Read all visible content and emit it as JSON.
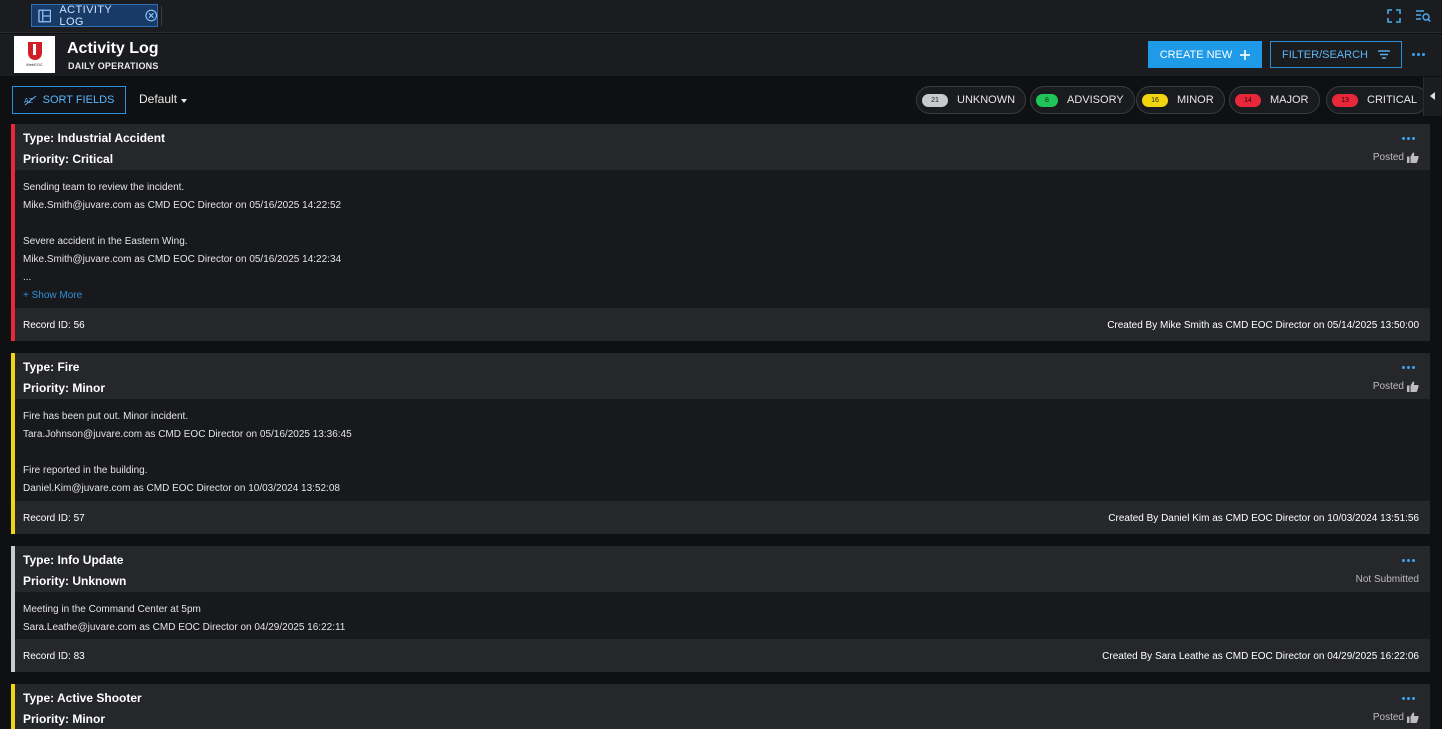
{
  "tab": {
    "label": "ACTIVITY LOG"
  },
  "header": {
    "title": "Activity Log",
    "subtitle": "DAILY OPERATIONS",
    "logo_text": "WebEOC"
  },
  "actions": {
    "create_new": "CREATE NEW",
    "filter_search": "FILTER/SEARCH"
  },
  "toolbar": {
    "sort_fields": "SORT FIELDS",
    "default_view": "Default"
  },
  "chips": [
    {
      "count": "21",
      "label": "UNKNOWN",
      "color": "#c8cacd"
    },
    {
      "count": "8",
      "label": "ADVISORY",
      "color": "#1fc45a"
    },
    {
      "count": "16",
      "label": "MINOR",
      "color": "#f1d60f"
    },
    {
      "count": "14",
      "label": "MAJOR",
      "color": "#e8283a"
    },
    {
      "count": "13",
      "label": "CRITICAL",
      "color": "#e8283a"
    }
  ],
  "cards": [
    {
      "type": "Type: Industrial Accident",
      "priority": "Priority: Critical",
      "status": "Posted",
      "bar_color": "#e8283a",
      "entries": [
        {
          "text": "Sending team to review the incident.",
          "meta": "Mike.Smith@juvare.com as CMD EOC Director on 05/16/2025 14:22:52"
        },
        {
          "text": "Severe accident in the Eastern Wing.",
          "meta": "Mike.Smith@juvare.com as CMD EOC Director on 05/16/2025 14:22:34"
        }
      ],
      "ellipsis": "...",
      "show_more": "+ Show More",
      "record_id": "Record ID:  56",
      "created": "Created By Mike Smith as CMD EOC Director on 05/14/2025 13:50:00"
    },
    {
      "type": "Type: Fire",
      "priority": "Priority: Minor",
      "status": "Posted",
      "bar_color": "#f1d60f",
      "entries": [
        {
          "text": "Fire has been put out. Minor incident.",
          "meta": "Tara.Johnson@juvare.com as CMD EOC Director on 05/16/2025 13:36:45"
        },
        {
          "text": "Fire reported in the building.",
          "meta": "Daniel.Kim@juvare.com as CMD EOC Director on 10/03/2024 13:52:08"
        }
      ],
      "record_id": "Record ID:  57",
      "created": "Created By Daniel Kim as CMD EOC Director on 10/03/2024 13:51:56"
    },
    {
      "type": "Type: Info Update",
      "priority": "Priority: Unknown",
      "status": "Not Submitted",
      "bar_color": "#c8cacd",
      "entries": [
        {
          "text": "Meeting in the Command Center at 5pm",
          "meta": "Sara.Leathe@juvare.com as CMD EOC Director on 04/29/2025 16:22:11"
        }
      ],
      "record_id": "Record ID:  83",
      "created": "Created By Sara Leathe as CMD EOC Director on 04/29/2025 16:22:06"
    },
    {
      "type": "Type: Active Shooter",
      "priority": "Priority: Minor",
      "status": "Posted",
      "bar_color": "#f1d60f"
    }
  ]
}
